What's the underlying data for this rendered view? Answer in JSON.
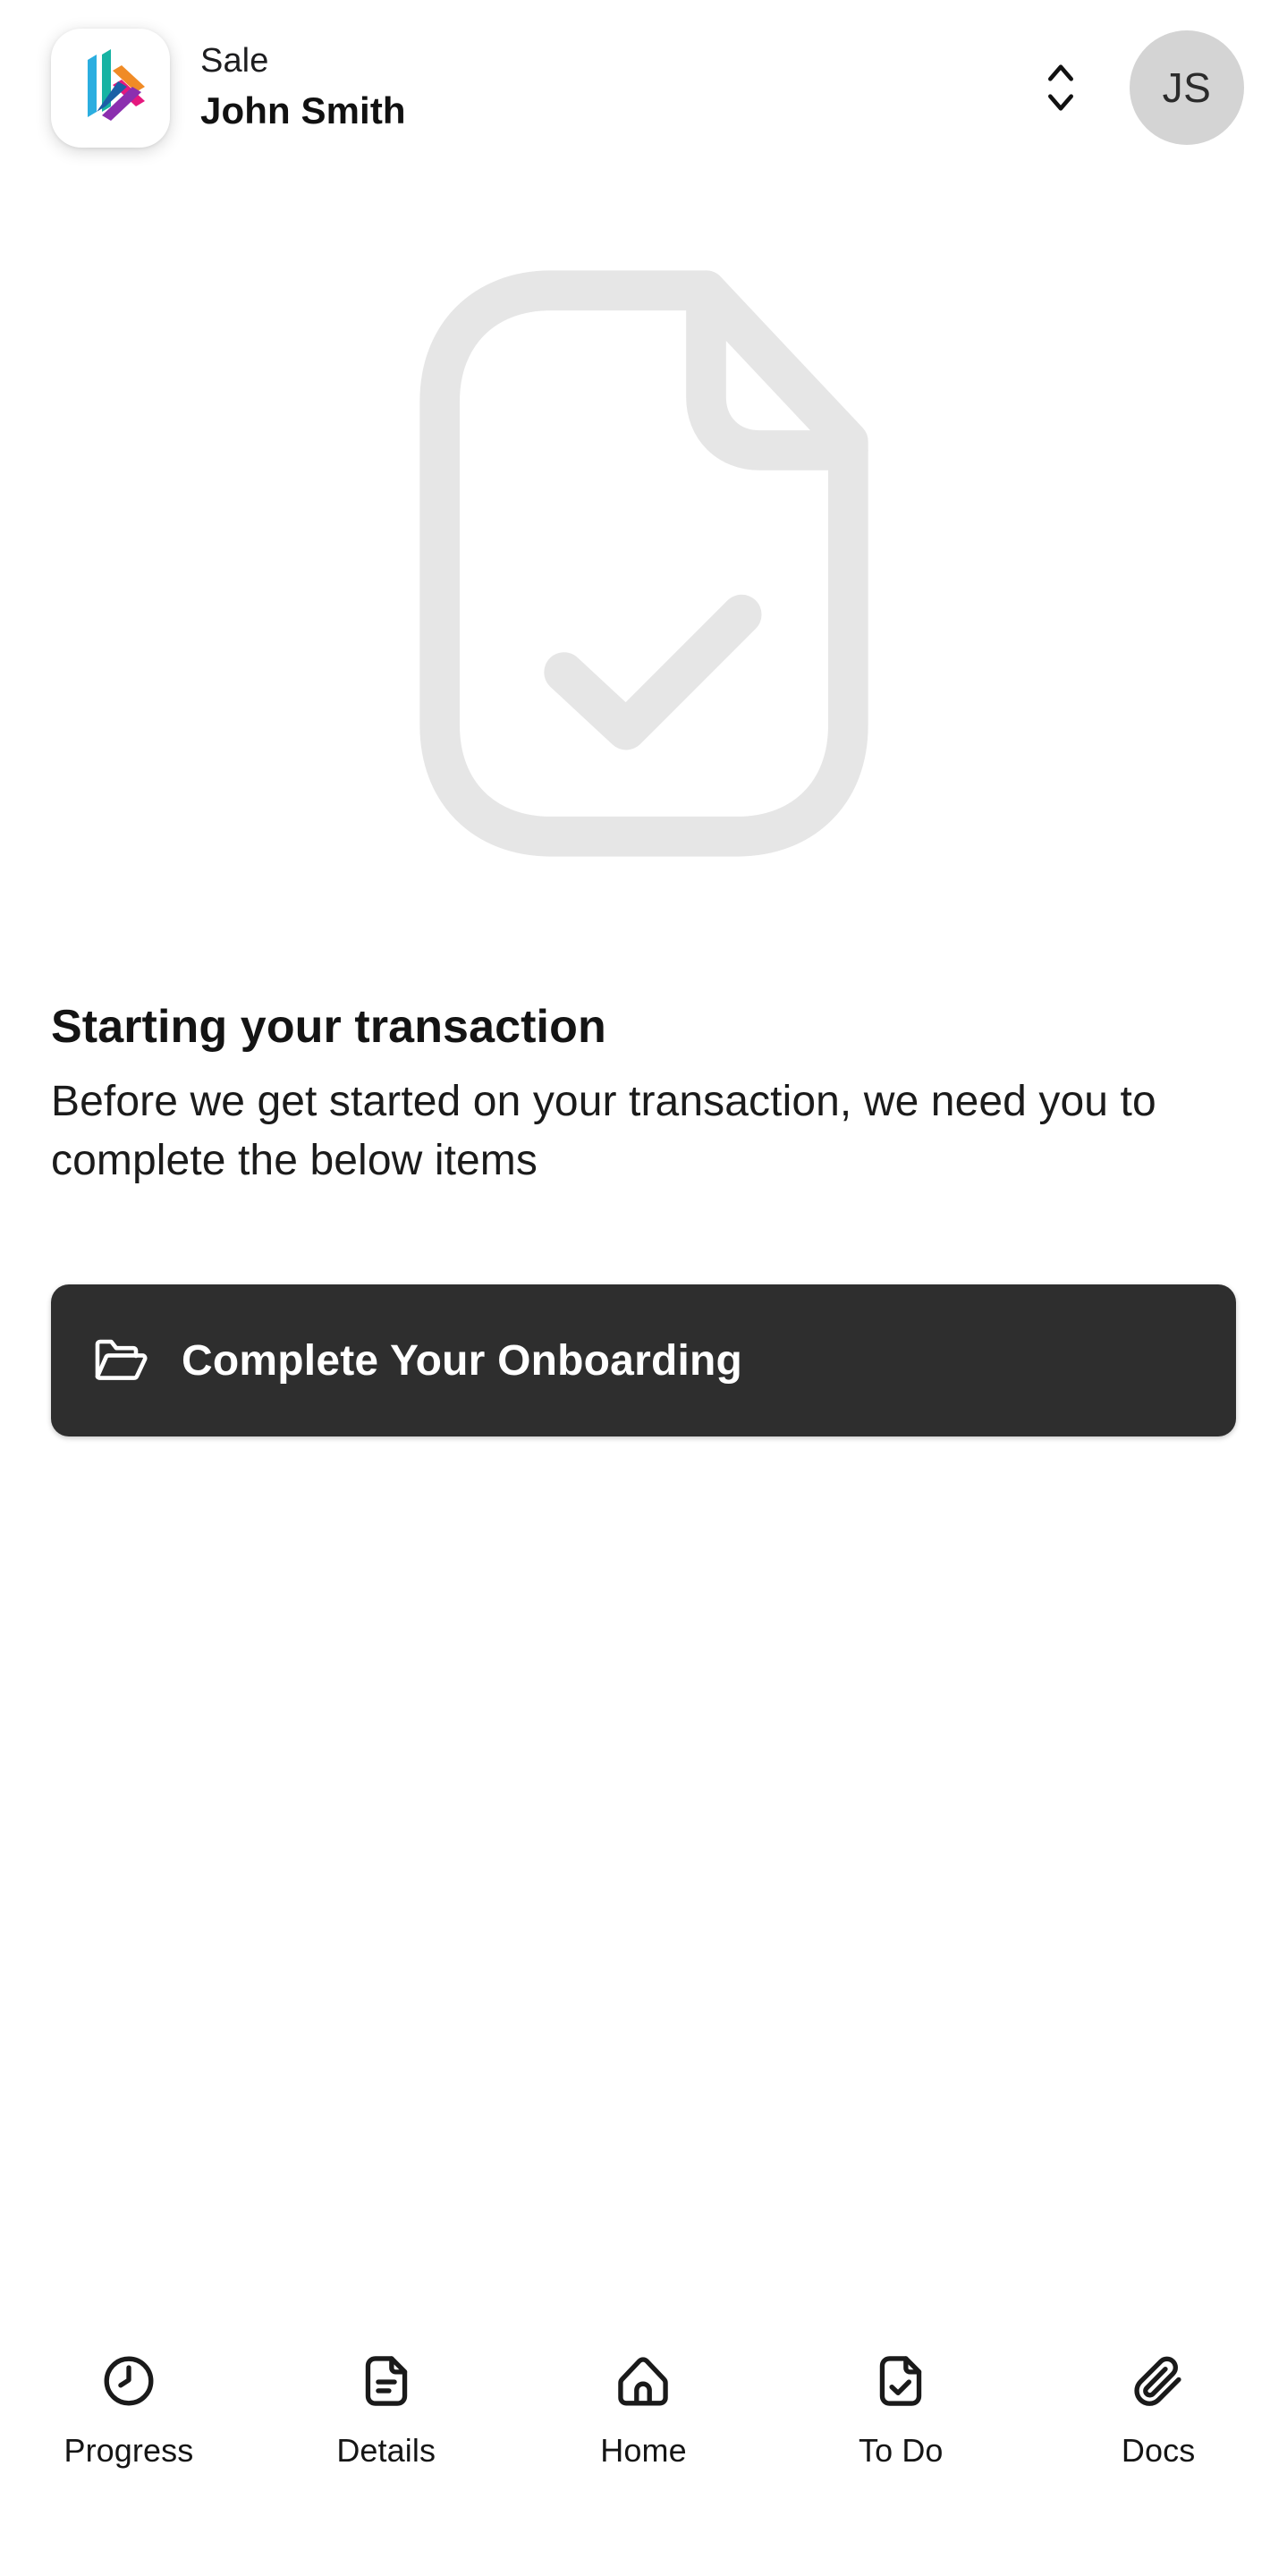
{
  "header": {
    "logo_icon": "brand-logo-icon",
    "kicker": "Sale",
    "name": "John Smith",
    "sort_icon": "chevron-up-down-icon",
    "avatar_initials": "JS",
    "avatar_bg": "#d4d4d4"
  },
  "hero": {
    "icon": "document-check-icon",
    "icon_color": "#e6e6e6"
  },
  "content": {
    "title": "Starting your transaction",
    "body": "Before we get started on your transaction, we need you to complete the below items"
  },
  "cta": {
    "icon": "folder-open-icon",
    "label": "Complete Your Onboarding",
    "background": "#2e2e2e",
    "text_color": "#ffffff"
  },
  "tabbar": {
    "items": [
      {
        "label": "Progress",
        "icon": "clock-icon"
      },
      {
        "label": "Details",
        "icon": "document-lines-icon"
      },
      {
        "label": "Home",
        "icon": "home-icon"
      },
      {
        "label": "To Do",
        "icon": "document-check-icon"
      },
      {
        "label": "Docs",
        "icon": "paperclip-icon"
      }
    ]
  }
}
